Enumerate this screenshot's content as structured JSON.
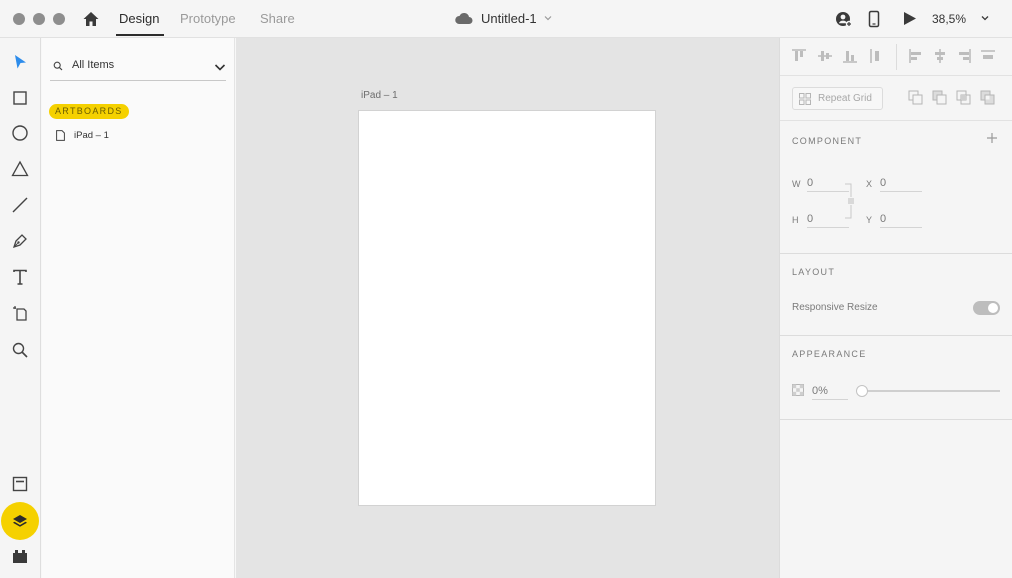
{
  "window": {
    "tabs": [
      {
        "label": "Design",
        "active": true
      },
      {
        "label": "Prototype",
        "active": false
      },
      {
        "label": "Share",
        "active": false
      }
    ],
    "document_title": "Untitled-1",
    "zoom": "38,5%"
  },
  "toolbar": {
    "tools": [
      "select-icon",
      "rectangle-icon",
      "ellipse-icon",
      "polygon-icon",
      "line-icon",
      "pen-icon",
      "text-icon",
      "artboard-icon",
      "zoom-icon"
    ],
    "bottom": [
      "assets-icon",
      "layers-icon",
      "plugins-icon"
    ],
    "active_color": "#f5d100"
  },
  "layers_panel": {
    "search_placeholder": "All Items",
    "section_label": "ARTBOARDS",
    "items": [
      {
        "label": "iPad – 1"
      }
    ]
  },
  "canvas": {
    "artboard_label": "iPad – 1"
  },
  "properties": {
    "repeat_grid_label": "Repeat Grid",
    "component": {
      "title": "COMPONENT",
      "w_label": "W",
      "w_value": "0",
      "h_label": "H",
      "h_value": "0",
      "x_label": "X",
      "x_value": "0",
      "y_label": "Y",
      "y_value": "0"
    },
    "layout": {
      "title": "LAYOUT",
      "responsive_resize_label": "Responsive Resize",
      "responsive_resize_on": true
    },
    "appearance": {
      "title": "APPEARANCE",
      "opacity": "0%"
    }
  }
}
